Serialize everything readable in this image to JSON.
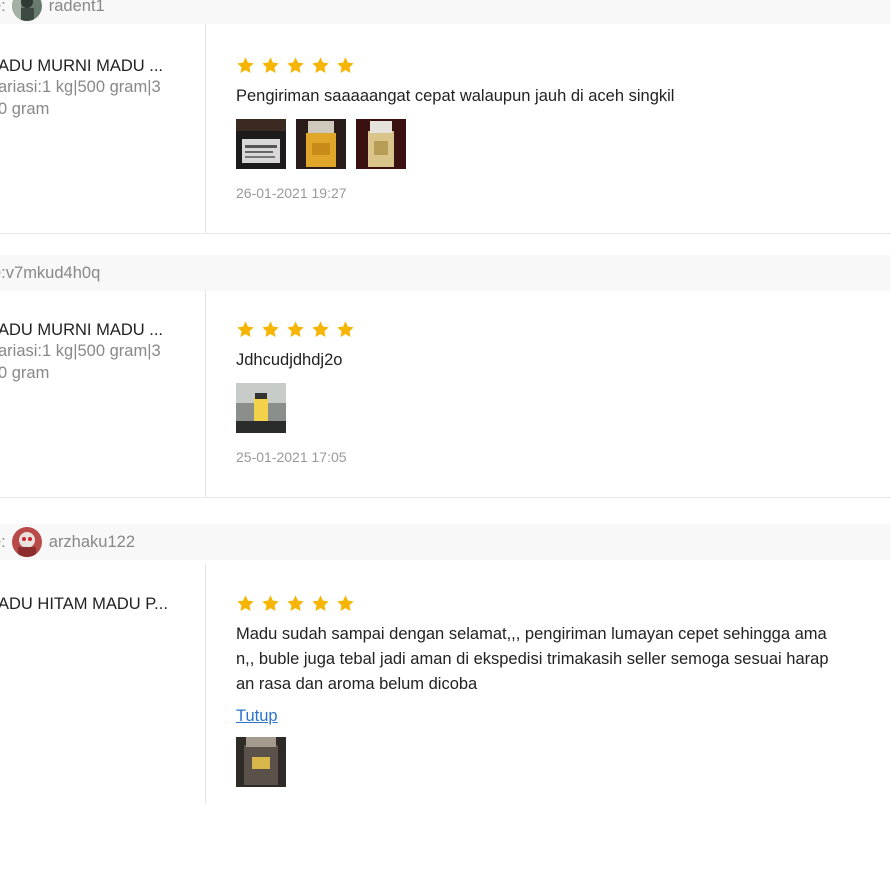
{
  "reviews": [
    {
      "buyer_prefix": "e:",
      "buyer_name": "radent1",
      "has_avatar": true,
      "product_name": "ADU MURNI MADU ...",
      "variant_lines": [
        "ariasi:1 kg|500 gram|3",
        "0 gram"
      ],
      "rating": 5,
      "comment": "Pengiriman saaaaangat cepat walaupun jauh di aceh singkil",
      "images": 3,
      "date": "26-01-2021 19:27"
    },
    {
      "buyer_prefix": "e:",
      "buyer_name": "v7mkud4h0q",
      "has_avatar": false,
      "product_name": "ADU MURNI MADU ...",
      "variant_lines": [
        "ariasi:1 kg|500 gram|3",
        "0 gram"
      ],
      "rating": 5,
      "comment": "Jdhcudjdhdj2o",
      "images": 1,
      "date": "25-01-2021 17:05"
    },
    {
      "buyer_prefix": "e:",
      "buyer_name": "arzhaku122",
      "has_avatar": true,
      "product_name": "ADU HITAM MADU P...",
      "variant_lines": [],
      "rating": 5,
      "comment_lines": [
        "Madu sudah sampai dengan selamat,,, pengiriman lumayan cepet sehingga ama",
        "n,, buble juga tebal jadi aman di ekspedisi trimakasih seller semoga sesuai harap",
        "an rasa dan aroma belum dicoba"
      ],
      "collapse_label": "Tutup",
      "images": 1
    }
  ],
  "colors": {
    "star": "#f6b501",
    "link": "#2b74c9",
    "bar_bg": "#f8f8f8"
  },
  "icons": {
    "star": "star-icon"
  }
}
